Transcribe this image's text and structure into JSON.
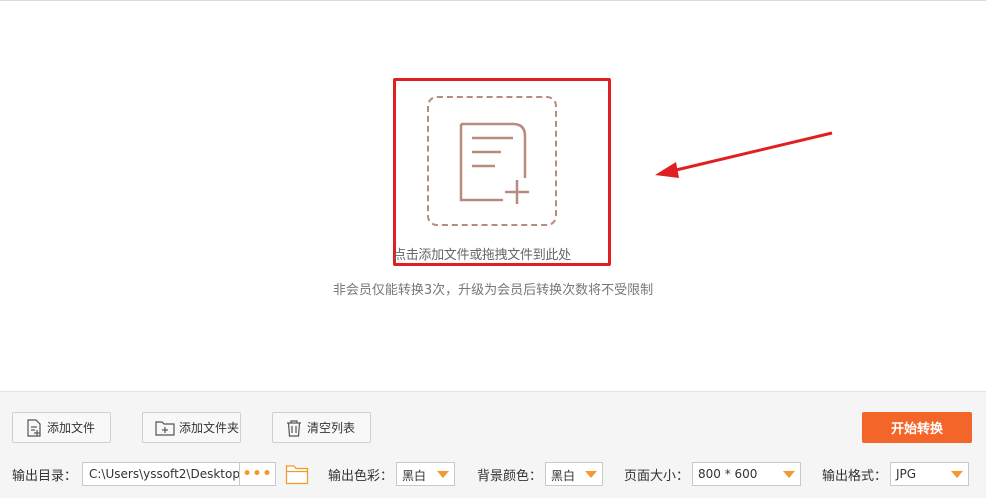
{
  "drop_zone": {
    "hint": "点击添加文件或拖拽文件到此处",
    "member_note": "非会员仅能转换3次，升级为会员后转换次数将不受限制"
  },
  "toolbar": {
    "add_file": "添加文件",
    "add_folder": "添加文件夹",
    "clear_list": "清空列表",
    "start": "开始转换"
  },
  "settings": {
    "output_dir_label": "输出目录：",
    "output_dir_value": "C:\\Users\\yssoft2\\Desktop\\",
    "more": "•••",
    "color_label": "输出色彩：",
    "color_value": "黑白",
    "bg_label": "背景颜色：",
    "bg_value": "黑白",
    "size_label": "页面大小：",
    "size_value": "800 * 600",
    "format_label": "输出格式：",
    "format_value": "JPG"
  },
  "colors": {
    "accent": "#f4652a",
    "highlight": "#e02020",
    "icon": "#b78b7e",
    "caret": "#f29a2e"
  },
  "icons": [
    "add-file-icon",
    "add-folder-icon",
    "trash-icon",
    "folder-icon",
    "document-add-icon",
    "arrow-annotation"
  ]
}
